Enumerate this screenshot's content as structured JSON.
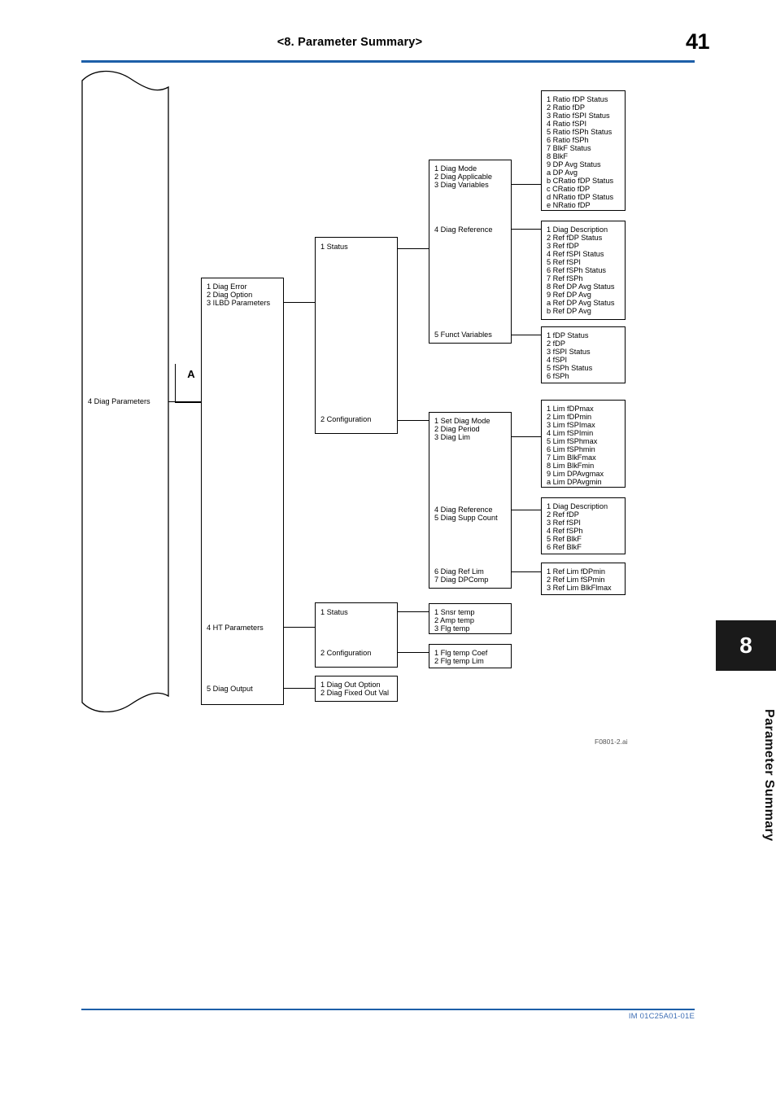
{
  "header": {
    "title": "<8.  Parameter Summary>",
    "page_number": "41"
  },
  "footer": {
    "doc_code": "IM 01C25A01-01E"
  },
  "chapter_tab": {
    "number": "8",
    "label": "Parameter Summary"
  },
  "figure": {
    "caption": "F0801-2.ai",
    "root_label": "4 Diag Parameters",
    "continuation_marker": "A"
  },
  "tree": {
    "col1_root": {
      "lines": [
        "1 Diag Error",
        "2 Diag Option",
        "3 ILBD Parameters"
      ],
      "mid_line": "4 HT Parameters",
      "last_line": "5 Diag Output"
    },
    "col2_ilbd": {
      "top": "1 Status",
      "bottom": "2 Configuration"
    },
    "col2_ht": {
      "top": "1 Status",
      "bottom": "2 Configuration"
    },
    "col2_diag_output": {
      "lines": [
        "1 Diag Out Option",
        "2 Diag Fixed Out Val"
      ]
    },
    "col3_status": {
      "group1": [
        "1 Diag Mode",
        "2 Diag Applicable",
        "3 Diag Variables"
      ],
      "group2": [
        "4 Diag Reference"
      ],
      "group3": [
        "5 Funct Variables"
      ]
    },
    "col3_config": {
      "group1": [
        "1 Set Diag Mode",
        "2 Diag Period",
        "3 Diag Lim"
      ],
      "group2": [
        "4 Diag Reference",
        "5 Diag Supp Count"
      ],
      "group3": [
        "6 Diag Ref Lim",
        "7 Diag DPComp"
      ]
    },
    "col3_ht_status": {
      "lines": [
        "1 Snsr temp",
        "2 Amp temp",
        "3 Flg temp"
      ]
    },
    "col3_ht_config": {
      "lines": [
        "1 Flg temp Coef",
        "2 Flg temp Lim"
      ]
    },
    "col4_diag_variables": {
      "lines": [
        "1 Ratio fDP Status",
        "2 Ratio fDP",
        "3 Ratio fSPI Status",
        "4 Ratio fSPI",
        "5 Ratio fSPh Status",
        "6 Ratio fSPh",
        "7 BlkF Status",
        "8 BlkF",
        "9 DP Avg Status",
        "a DP Avg",
        "b CRatio fDP Status",
        "c CRatio fDP",
        "d NRatio fDP Status",
        "e NRatio fDP"
      ]
    },
    "col4_diag_reference": {
      "lines": [
        "1 Diag Description",
        "2 Ref fDP Status",
        "3 Ref fDP",
        "4 Ref fSPI Status",
        "5 Ref fSPI",
        "6 Ref fSPh Status",
        "7 Ref fSPh",
        "8 Ref DP Avg Status",
        "9 Ref DP Avg",
        "a Ref DP Avg Status",
        "b Ref DP Avg"
      ]
    },
    "col4_funct_variables": {
      "lines": [
        "1 fDP Status",
        "2 fDP",
        "3 fSPI Status",
        "4 fSPI",
        "5 fSPh Status",
        "6 fSPh"
      ]
    },
    "col4_diag_lim": {
      "lines": [
        "1 Lim fDPmax",
        "2 Lim fDPmin",
        "3 Lim fSPImax",
        "4 Lim fSPImin",
        "5 Lim fSPhmax",
        "6 Lim fSPhmin",
        "7 Lim BlkFmax",
        "8 Lim BlkFmin",
        "9 Lim DPAvgmax",
        "a Lim DPAvgmin"
      ]
    },
    "col4_diag_reference2": {
      "lines": [
        "1 Diag Description",
        "2 Ref fDP",
        "3 Ref fSPI",
        "4 Ref fSPh",
        "5 Ref BlkF",
        "6 Ref BlkF"
      ]
    },
    "col4_diag_ref_lim": {
      "lines": [
        "1 Ref Lim fDPmin",
        "2 Ref Lim fSPmin",
        "3 Ref Lim BlkFlmax"
      ]
    }
  }
}
